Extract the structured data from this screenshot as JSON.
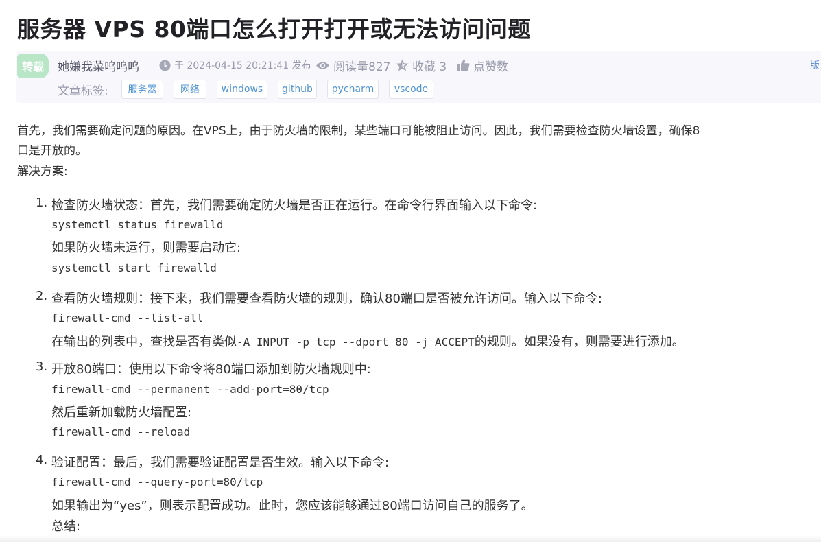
{
  "article": {
    "title": "服务器 VPS 80端口怎么打开打开或无法访问问题"
  },
  "meta": {
    "badge": "转载",
    "author": "她嫌我菜呜呜呜",
    "published": "于 2024-04-15 20:21:41 发布",
    "views": "阅读量827",
    "favorites": "收藏 3",
    "likes": "点赞数",
    "edge_link": "版",
    "tags_label": "文章标签:",
    "tags": [
      "服务器",
      "网络",
      "windows",
      "github",
      "pycharm",
      "vscode"
    ]
  },
  "content": {
    "intro_line1": "首先，我们需要确定问题的原因。在VPS上，由于防火墙的限制，某些端口可能被阻止访问。因此，我们需要检查防火墙设置，确保8",
    "intro_line2": "口是开放的。",
    "solution_heading": "解决方案:",
    "steps": [
      {
        "num": "1.",
        "title": "检查防火墙状态：首先，我们需要确定防火墙是否正在运行。在命令行界面输入以下命令:",
        "cmd1": "systemctl status firewalld",
        "text": "如果防火墙未运行，则需要启动它:",
        "cmd2": "systemctl start firewalld"
      },
      {
        "num": "2.",
        "title": "查看防火墙规则：接下来，我们需要查看防火墙的规则，确认80端口是否被允许访问。输入以下命令:",
        "cmd1": "firewall-cmd --list-all",
        "text_before": "在输出的列表中，查找是否有类似",
        "text_code": "-A INPUT -p tcp --dport 80 -j ACCEPT",
        "text_after": "的规则。如果没有，则需要进行添加。"
      },
      {
        "num": "3.",
        "title": "开放80端口：使用以下命令将80端口添加到防火墙规则中:",
        "cmd1": "firewall-cmd --permanent --add-port=80/tcp",
        "text": "然后重新加载防火墙配置:",
        "cmd2": "firewall-cmd --reload"
      },
      {
        "num": "4.",
        "title": "验证配置：最后，我们需要验证配置是否生效。输入以下命令:",
        "cmd1": "firewall-cmd --query-port=80/tcp",
        "text": "如果输出为“yes”，则表示配置成功。此时，您应该能够通过80端口访问自己的服务了。",
        "summary": "总结:"
      }
    ]
  }
}
